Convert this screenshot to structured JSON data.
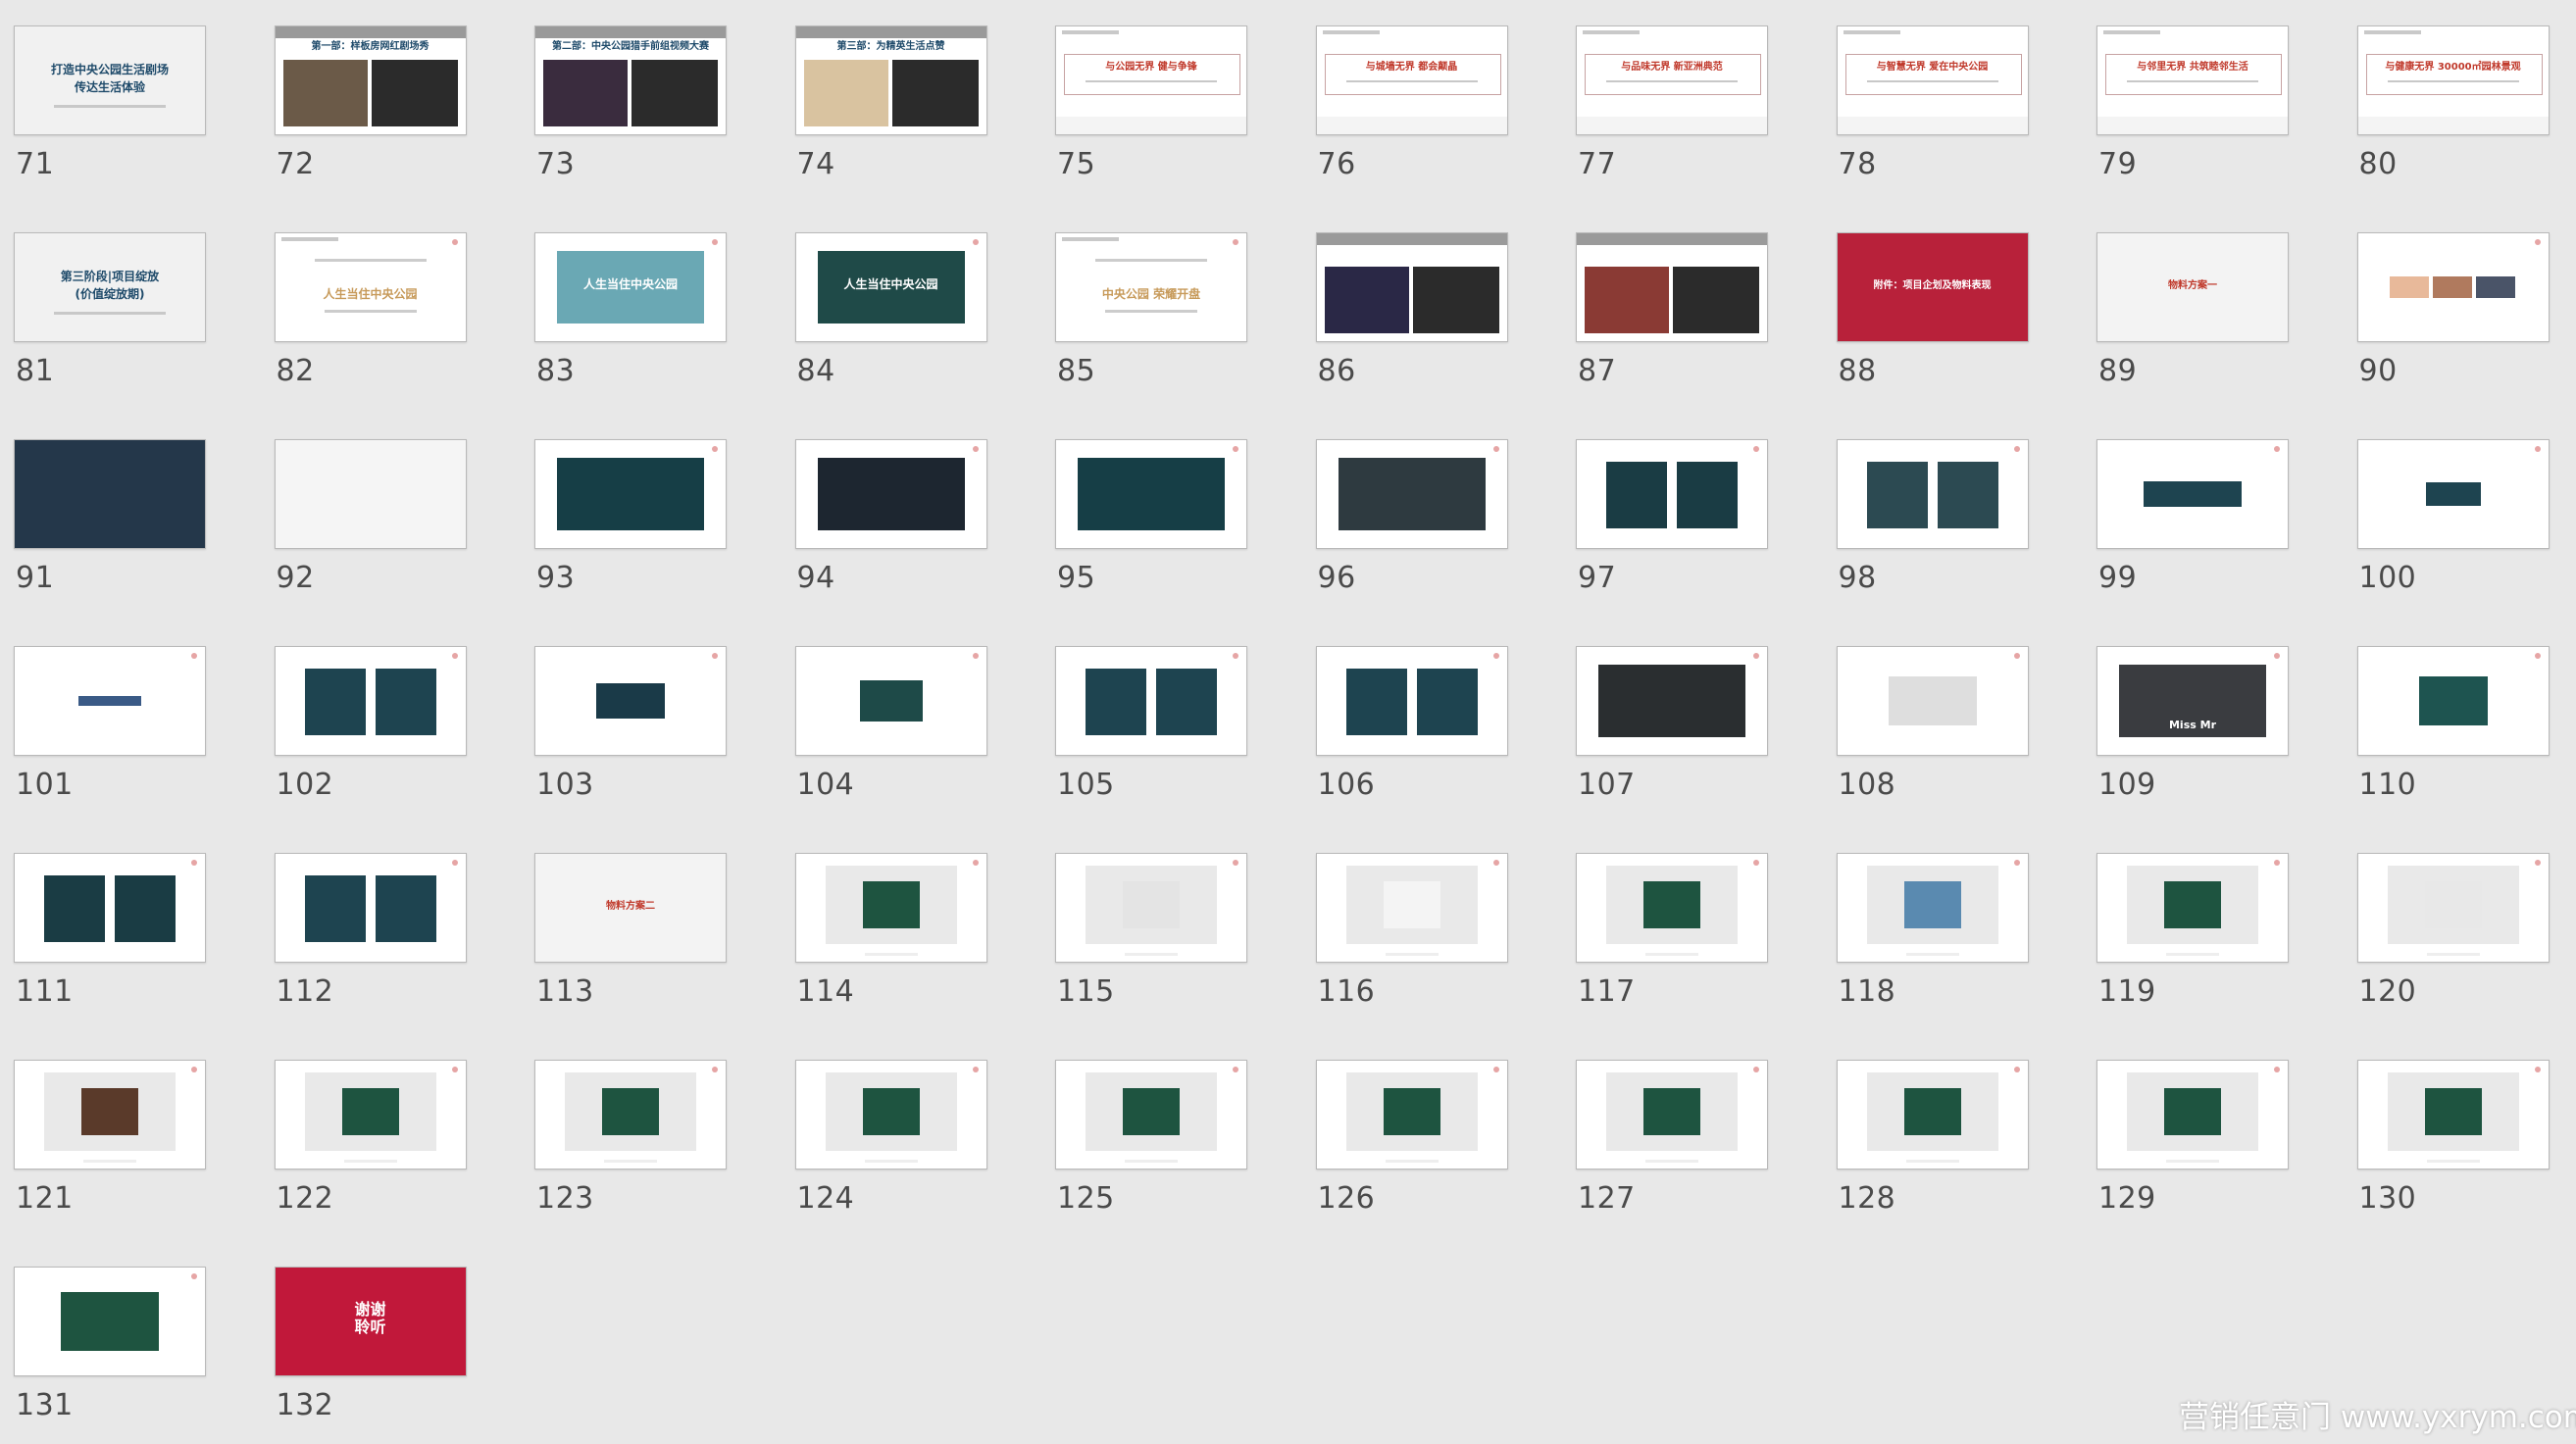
{
  "view": "slide-sorter",
  "slides": [
    {
      "n": "71",
      "kind": "grey-text",
      "lines": [
        "打造中央公园生活剧场",
        "传达生活体验"
      ]
    },
    {
      "n": "72",
      "kind": "header-photos",
      "title": "第一部：样板房网红剧场秀",
      "photo": "#6b5a48"
    },
    {
      "n": "73",
      "kind": "header-photos",
      "title": "第二部：中央公园猎手前组视频大赛",
      "photo": "#3a2c3e"
    },
    {
      "n": "74",
      "kind": "header-photos",
      "title": "第三部：为精英生活点赞",
      "photo": "#d9c3a0"
    },
    {
      "n": "75",
      "kind": "box-title",
      "title": "与公园无界 健与争锋"
    },
    {
      "n": "76",
      "kind": "box-title",
      "title": "与城墙无界 都会颠晶"
    },
    {
      "n": "77",
      "kind": "box-title",
      "title": "与品味无界 新亚洲典范"
    },
    {
      "n": "78",
      "kind": "box-title",
      "title": "与智慧无界 爱在中央公园"
    },
    {
      "n": "79",
      "kind": "box-title",
      "title": "与邻里无界 共筑睦邻生活"
    },
    {
      "n": "80",
      "kind": "box-title",
      "title": "与健康无界 30000㎡园林景观"
    },
    {
      "n": "81",
      "kind": "grey-text",
      "lines": [
        "第三阶段|项目绽放",
        "(价值绽放期)"
      ]
    },
    {
      "n": "82",
      "kind": "white-text",
      "title": "人生当住中央公园",
      "color": "#c79a5a"
    },
    {
      "n": "83",
      "kind": "banner",
      "bg": "#6aa8b4",
      "title": "人生当住中央公园"
    },
    {
      "n": "84",
      "kind": "banner",
      "bg": "#1f4a48",
      "title": "人生当住中央公园"
    },
    {
      "n": "85",
      "kind": "white-text",
      "title": "中央公园 荣耀开盘",
      "color": "#c79a5a"
    },
    {
      "n": "86",
      "kind": "header-photos",
      "title": "",
      "photo": "#2a2846"
    },
    {
      "n": "87",
      "kind": "header-photos",
      "title": "",
      "photo": "#8a3a34"
    },
    {
      "n": "88",
      "kind": "full",
      "bg": "#b8213a",
      "title": "附件：项目企划及物料表现",
      "tcolor": "#ffffff"
    },
    {
      "n": "89",
      "kind": "full",
      "bg": "#f3f3f3",
      "title": "物料方案一",
      "tcolor": "#c0392b"
    },
    {
      "n": "90",
      "kind": "swatches",
      "colors": [
        "#e8b99a",
        "#b07a5e",
        "#4a5468"
      ]
    },
    {
      "n": "91",
      "kind": "full",
      "bg": "#24374a",
      "title": "",
      "tcolor": "#ffffff"
    },
    {
      "n": "92",
      "kind": "full",
      "bg": "#f5f5f5",
      "title": "",
      "tcolor": "#d9c2b0"
    },
    {
      "n": "93",
      "kind": "banner",
      "bg": "#163e46",
      "title": ""
    },
    {
      "n": "94",
      "kind": "banner",
      "bg": "#1d2630",
      "title": ""
    },
    {
      "n": "95",
      "kind": "banner",
      "bg": "#163e46",
      "title": ""
    },
    {
      "n": "96",
      "kind": "banner",
      "bg": "#2e3a40",
      "title": ""
    },
    {
      "n": "97",
      "kind": "duo",
      "bg": "#1a3c44"
    },
    {
      "n": "98",
      "kind": "duo",
      "bg": "#2c4a52"
    },
    {
      "n": "99",
      "kind": "small",
      "bg": "#1e4450",
      "w": 100,
      "h": 26
    },
    {
      "n": "100",
      "kind": "small",
      "bg": "#1e4450",
      "w": 56,
      "h": 24
    },
    {
      "n": "101",
      "kind": "small",
      "bg": "#3a5a86",
      "w": 64,
      "h": 10
    },
    {
      "n": "102",
      "kind": "duo",
      "bg": "#1e4450"
    },
    {
      "n": "103",
      "kind": "small",
      "bg": "#1a3a48",
      "w": 70,
      "h": 36
    },
    {
      "n": "104",
      "kind": "small",
      "bg": "#1e4a48",
      "w": 64,
      "h": 42
    },
    {
      "n": "105",
      "kind": "duo",
      "bg": "#1e4450"
    },
    {
      "n": "106",
      "kind": "duo",
      "bg": "#1e4450"
    },
    {
      "n": "107",
      "kind": "banner",
      "bg": "#2a2e30",
      "title": ""
    },
    {
      "n": "108",
      "kind": "small",
      "bg": "#dedede",
      "w": 90,
      "h": 50
    },
    {
      "n": "109",
      "kind": "banner",
      "bg": "#3a3c40",
      "title": "Miss  Mr"
    },
    {
      "n": "110",
      "kind": "small",
      "bg": "#1e5450",
      "w": 70,
      "h": 50
    },
    {
      "n": "111",
      "kind": "duo",
      "bg": "#1a3c44"
    },
    {
      "n": "112",
      "kind": "duo",
      "bg": "#1e4450"
    },
    {
      "n": "113",
      "kind": "full",
      "bg": "#f3f3f3",
      "title": "物料方案二",
      "tcolor": "#c0392b"
    },
    {
      "n": "114",
      "kind": "mock",
      "bg": "#1e5440"
    },
    {
      "n": "115",
      "kind": "mock",
      "bg": "#e4e4e4"
    },
    {
      "n": "116",
      "kind": "mock",
      "bg": "#f4f4f4"
    },
    {
      "n": "117",
      "kind": "mock",
      "bg": "#1e5440"
    },
    {
      "n": "118",
      "kind": "mock",
      "bg": "#5a8ab0"
    },
    {
      "n": "119",
      "kind": "mock",
      "bg": "#1e5440"
    },
    {
      "n": "120",
      "kind": "mock",
      "bg": "#e8e8e8"
    },
    {
      "n": "121",
      "kind": "mock",
      "bg": "#5a3a2a"
    },
    {
      "n": "122",
      "kind": "mock",
      "bg": "#1e5440"
    },
    {
      "n": "123",
      "kind": "mock",
      "bg": "#1e5440"
    },
    {
      "n": "124",
      "kind": "mock",
      "bg": "#1e5440"
    },
    {
      "n": "125",
      "kind": "mock",
      "bg": "#1e5440"
    },
    {
      "n": "126",
      "kind": "mock",
      "bg": "#1e5440"
    },
    {
      "n": "127",
      "kind": "mock",
      "bg": "#1e5440"
    },
    {
      "n": "128",
      "kind": "mock",
      "bg": "#1e5440"
    },
    {
      "n": "129",
      "kind": "mock",
      "bg": "#1e5440"
    },
    {
      "n": "130",
      "kind": "mock",
      "bg": "#1e5440"
    },
    {
      "n": "131",
      "kind": "small",
      "bg": "#1e5440",
      "w": 100,
      "h": 60
    },
    {
      "n": "132",
      "kind": "full",
      "bg": "#c1183a",
      "title": "谢谢\n聆听",
      "tcolor": "#ffffff"
    }
  ],
  "watermark": "营销任意门 www.yxrym.com"
}
